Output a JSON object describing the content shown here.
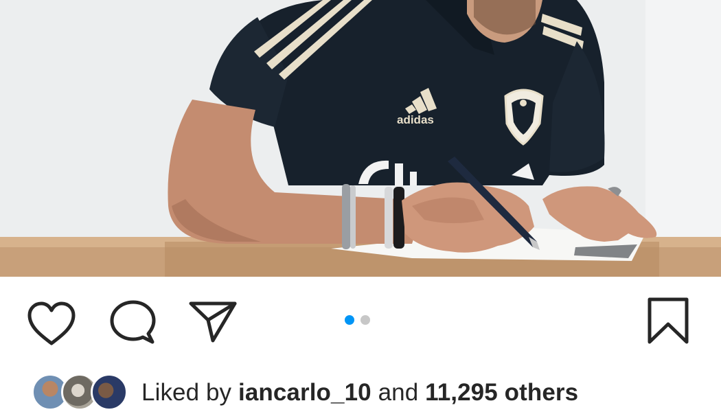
{
  "post": {
    "photo_alt": "Man in dark Leeds United polo signing a contract at a wooden desk",
    "shirt_logo_text": "adidas",
    "carousel": {
      "total": 2,
      "active_index": 0
    }
  },
  "actions": {
    "like_icon": "heart-icon",
    "comment_icon": "comment-icon",
    "share_icon": "share-icon",
    "save_icon": "bookmark-icon"
  },
  "likes": {
    "prefix": "Liked by",
    "username": "iancarlo_10",
    "conjunction": "and",
    "others": "11,295 others"
  },
  "colors": {
    "accent": "#0095f6",
    "inactive_dot": "#c7c7c7",
    "text": "#262626"
  }
}
